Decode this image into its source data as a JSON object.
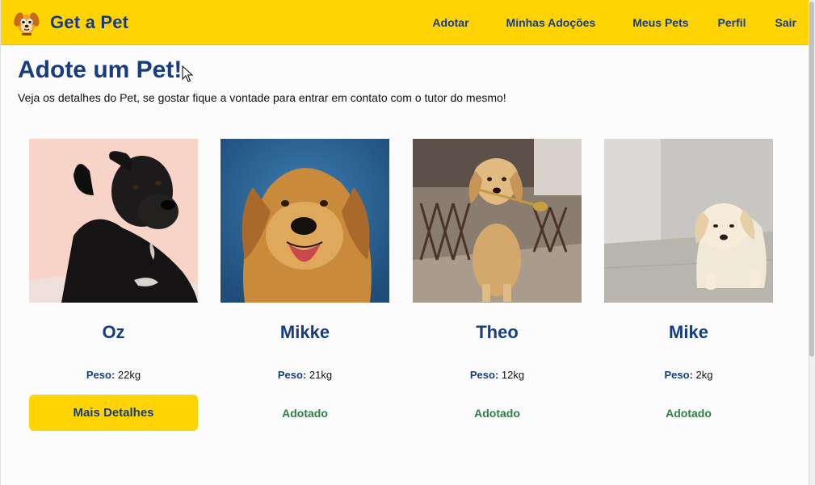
{
  "brand": {
    "name": "Get a Pet",
    "logo": "dog-face-logo"
  },
  "nav": {
    "items": [
      {
        "label": "Adotar"
      },
      {
        "label": "Minhas Adoções"
      },
      {
        "label": "Meus Pets"
      },
      {
        "label": "Perfil"
      },
      {
        "label": "Sair"
      }
    ]
  },
  "page": {
    "title": "Adote um Pet!",
    "subtitle": "Veja os detalhes do Pet, se gostar fique a vontade para entrar em contato com o tutor do mesmo!"
  },
  "weight_label": "Peso:",
  "pets": [
    {
      "name": "Oz",
      "weight": "22kg",
      "action": "Mais Detalhes",
      "status": ""
    },
    {
      "name": "Mikke",
      "weight": "21kg",
      "action": "",
      "status": "Adotado"
    },
    {
      "name": "Theo",
      "weight": "12kg",
      "action": "",
      "status": "Adotado"
    },
    {
      "name": "Mike",
      "weight": "2kg",
      "action": "",
      "status": "Adotado"
    }
  ],
  "colors": {
    "accent": "#ffd400",
    "brand_text": "#163d82",
    "adopted": "#2e7d46"
  }
}
